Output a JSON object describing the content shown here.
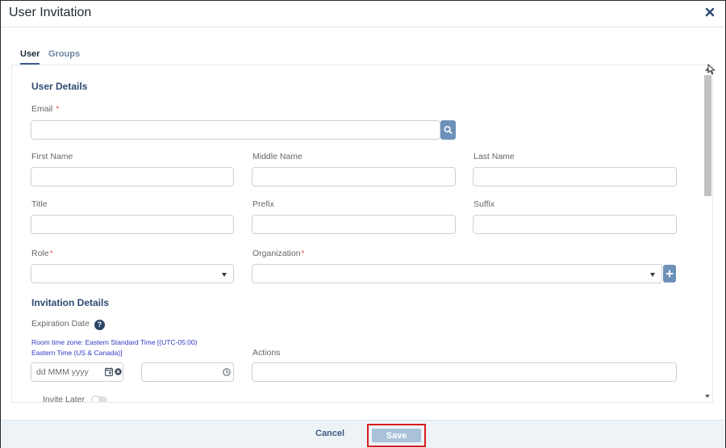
{
  "dialog": {
    "title": "User Invitation"
  },
  "tabs": [
    {
      "label": "User",
      "active": true
    },
    {
      "label": "Groups",
      "active": false
    }
  ],
  "user_details": {
    "section_title": "User Details",
    "email_label": "Email",
    "required_mark": "*",
    "email_value": "",
    "first_name_label": "First Name",
    "middle_name_label": "Middle Name",
    "last_name_label": "Last Name",
    "title_label": "Title",
    "prefix_label": "Prefix",
    "suffix_label": "Suffix",
    "role_label": "Role",
    "role_value": "",
    "organization_label": "Organization",
    "organization_value": ""
  },
  "invitation_details": {
    "section_title": "Invitation Details",
    "expiration_label": "Expiration Date",
    "help_glyph": "?",
    "tz_line1": "Room time zone: Eastern Standard Time [(UTC-05:00)",
    "tz_line2": "Eastern Time (US & Canada)]",
    "date_placeholder": "dd MMM yyyy",
    "actions_label": "Actions",
    "invite_later_label": "Invite Later",
    "invite_later_on": false
  },
  "footer": {
    "cancel_label": "Cancel",
    "save_label": "Save"
  },
  "icons": {
    "close": "close-icon",
    "search": "search-icon",
    "add": "plus-icon",
    "calendar": "calendar-icon",
    "clear": "clear-icon",
    "clock": "clock-icon",
    "help": "help-icon"
  },
  "colors": {
    "accent": "#6d91b8",
    "heading": "#2d4a72",
    "required": "#e05a5a",
    "timezone_text": "#3238c2",
    "save_disabled": "#a9c2da",
    "highlight": "#d61c1c",
    "footer_bg": "#eef3f8"
  }
}
